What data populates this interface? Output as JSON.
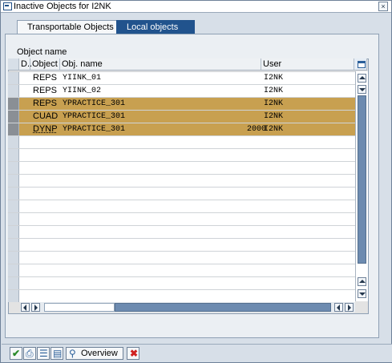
{
  "window": {
    "title": "Inactive Objects for I2NK"
  },
  "tabs": [
    {
      "label": "Transportable Objects",
      "active": false
    },
    {
      "label": "Local objects",
      "active": true
    }
  ],
  "section": {
    "label": "Object name"
  },
  "table": {
    "columns": [
      "D..",
      "Object",
      "Obj. name",
      "User"
    ],
    "rows": [
      {
        "object": "REPS",
        "name": "YIINK_01",
        "num": "",
        "user": "I2NK",
        "highlight": false
      },
      {
        "object": "REPS",
        "name": "YIINK_02",
        "num": "",
        "user": "I2NK",
        "highlight": false
      },
      {
        "object": "REPS",
        "name": "YPRACTICE_301",
        "num": "",
        "user": "I2NK",
        "highlight": true
      },
      {
        "object": "CUAD",
        "name": "YPRACTICE_301",
        "num": "",
        "user": "I2NK",
        "highlight": true
      },
      {
        "object": "DYNP",
        "name": "YPRACTICE_301",
        "num": "2000",
        "user": "I2NK",
        "highlight": true
      }
    ]
  },
  "toolbar": {
    "overview_label": "Overview"
  },
  "colors": {
    "highlight_row": "#c8a050",
    "tab_active": "#21538d"
  },
  "icons": {
    "close": "close-icon",
    "check": "checkmark-icon",
    "print": "print-icon",
    "list": "list-icon",
    "doc": "document-icon",
    "overview": "overview-icon",
    "cancel": "cancel-icon",
    "config": "table-settings-icon"
  }
}
